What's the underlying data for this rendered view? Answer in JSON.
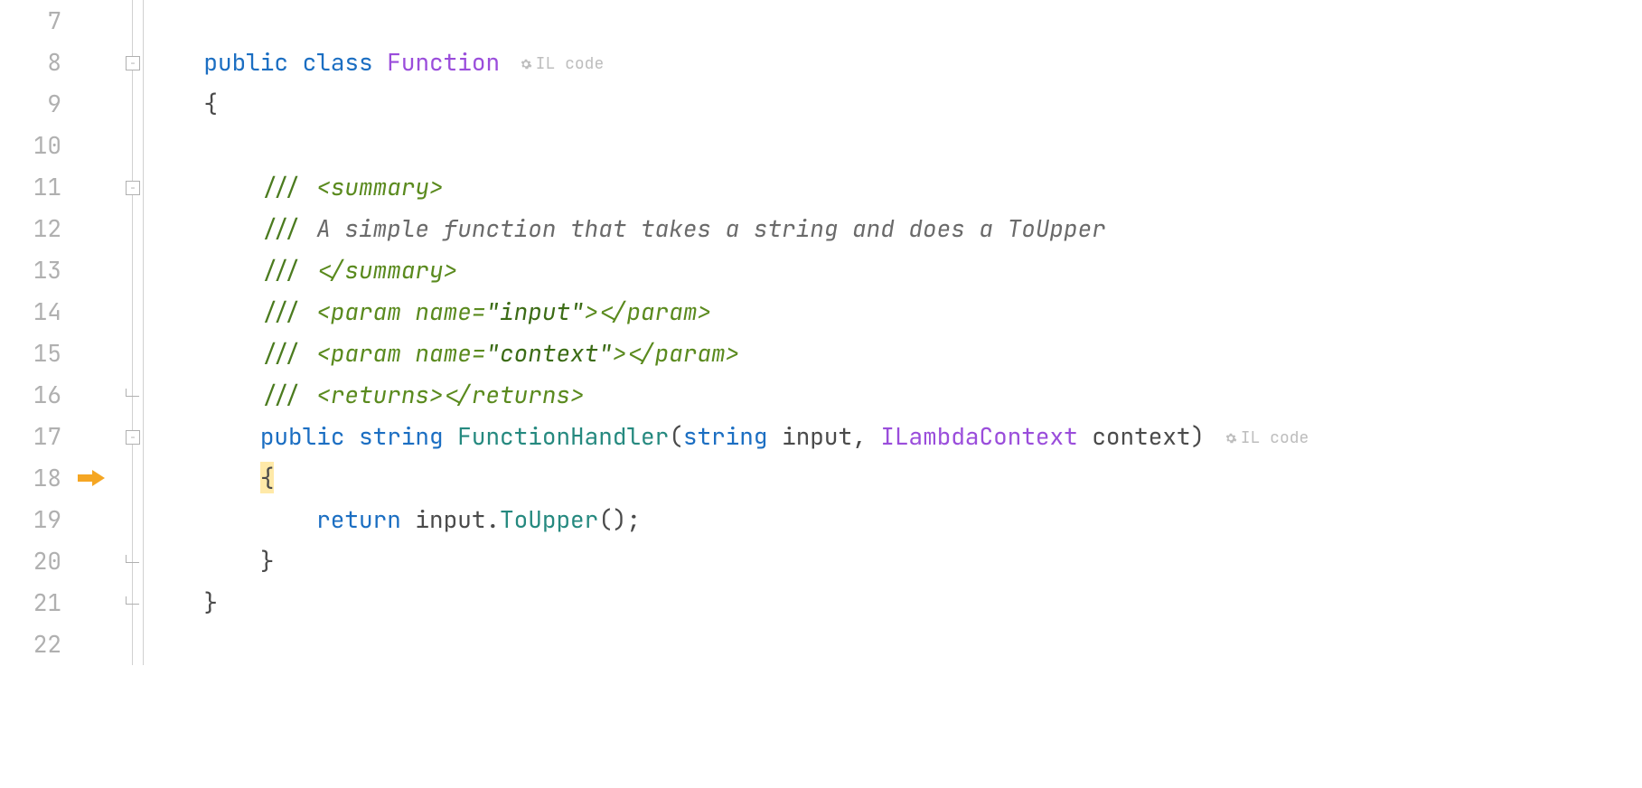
{
  "editor": {
    "first_line_no": 7,
    "active_line_no": 18,
    "inlay_label": "IL code",
    "fold_markers": {
      "open_at": [
        8,
        11,
        17
      ],
      "close_at": [
        16,
        20,
        21
      ]
    },
    "lines": {
      "7": {
        "indent": 0,
        "kind": "blank"
      },
      "8": {
        "indent": 1,
        "kind": "class_decl",
        "kw1": "public",
        "kw2": "class",
        "name": "Function",
        "inlay": true
      },
      "9": {
        "indent": 1,
        "kind": "brace_open"
      },
      "10": {
        "indent": 1,
        "kind": "blank"
      },
      "11": {
        "indent": 2,
        "kind": "doc_tag_open",
        "tag": "summary"
      },
      "12": {
        "indent": 2,
        "kind": "doc_text",
        "text": "A simple function that takes a string and does a ToUpper"
      },
      "13": {
        "indent": 2,
        "kind": "doc_tag_close",
        "tag": "summary"
      },
      "14": {
        "indent": 2,
        "kind": "doc_param",
        "tag": "param",
        "attr": "name",
        "val": "input"
      },
      "15": {
        "indent": 2,
        "kind": "doc_param",
        "tag": "param",
        "attr": "name",
        "val": "context"
      },
      "16": {
        "indent": 2,
        "kind": "doc_selfclose",
        "tag": "returns"
      },
      "17": {
        "indent": 2,
        "kind": "method_decl",
        "kw": "public",
        "rettype": "string",
        "name": "FunctionHandler",
        "params": [
          {
            "type": "string",
            "name": "input"
          },
          {
            "type": "ILambdaContext",
            "name": "context"
          }
        ],
        "inlay": true
      },
      "18": {
        "indent": 2,
        "kind": "brace_open_hl"
      },
      "19": {
        "indent": 3,
        "kind": "return_call",
        "kw": "return",
        "obj": "input",
        "method": "ToUpper"
      },
      "20": {
        "indent": 2,
        "kind": "brace_close"
      },
      "21": {
        "indent": 1,
        "kind": "brace_close"
      },
      "22": {
        "indent": 0,
        "kind": "blank"
      }
    }
  }
}
